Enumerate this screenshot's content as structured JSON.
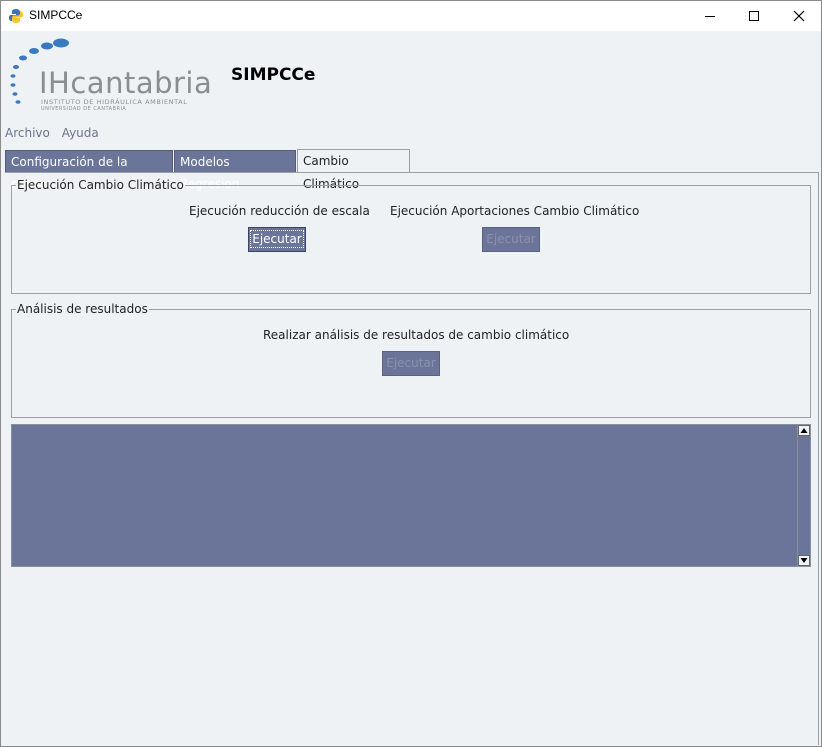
{
  "window": {
    "title": "SIMPCCe"
  },
  "header": {
    "logo_text": "IHcantabria",
    "logo_line1": "INSTITUTO DE HIDRÁULICA AMBIENTAL",
    "logo_line2": "UNIVERSIDAD DE CANTABRIA",
    "app_name": "SIMPCCe"
  },
  "menu": {
    "items": [
      {
        "label": "Archivo"
      },
      {
        "label": "Ayuda"
      }
    ]
  },
  "tabs": [
    {
      "label": "Configuración de la cuenca",
      "active": false
    },
    {
      "label": "Modelos Regresion",
      "active": false
    },
    {
      "label": "Cambio Climático",
      "active": true
    }
  ],
  "climate_group": {
    "legend": "Ejecución Cambio Climático",
    "downscaling_label": "Ejecución reducción de escala",
    "downscaling_button": "Ejecutar",
    "contributions_label": "Ejecución Aportaciones Cambio Climático",
    "contributions_button": "Ejecutar"
  },
  "analysis_group": {
    "legend": "Análisis de resultados",
    "label": "Realizar análisis de resultados de cambio climático",
    "button": "Ejecutar"
  },
  "log_area": {
    "value": ""
  },
  "colors": {
    "accent": "#6b7599",
    "background": "#eef2f4",
    "logo_blue": "#3a78c0",
    "logo_gray": "#8a8d92"
  }
}
